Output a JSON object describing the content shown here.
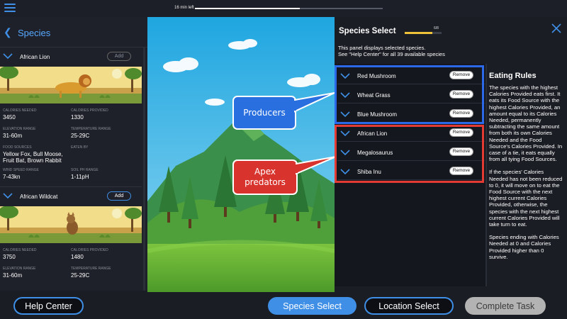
{
  "topbar": {
    "menu_icon": "hamburger-icon",
    "time_left": "16 min left",
    "progress": 0.56
  },
  "left_panel": {
    "title": "Species",
    "cards": [
      {
        "name": "African Lion",
        "add_label": "Add",
        "calories_needed_label": "CALORIES NEEDED",
        "calories_needed": "3450",
        "calories_provided_label": "CALORIES PROVIDED",
        "calories_provided": "1330",
        "elevation_label": "ELEVATION RANGE",
        "elevation": "31-60m",
        "temperature_label": "TEMPERATURE RANGE",
        "temperature": "25-29C",
        "food_sources_label": "FOOD SOURCES",
        "food_sources": "Yellow Fox, Bull Moose, Fruit Bat, Brown Rabbit",
        "eaten_by_label": "EATEN BY",
        "eaten_by": "",
        "wind_label": "WIND SPEED RANGE",
        "wind": "7-43kn",
        "soil_label": "SOIL PH RANGE",
        "soil": "1-11pH"
      },
      {
        "name": "African Wildcat",
        "add_label": "Add",
        "calories_needed_label": "CALORIES NEEDED",
        "calories_needed": "3750",
        "calories_provided_label": "CALORIES PROVIDED",
        "calories_provided": "1480",
        "elevation_label": "ELEVATION RANGE",
        "elevation": "31-60m",
        "temperature_label": "TEMPERATURE RANGE",
        "temperature": "25-29C"
      }
    ]
  },
  "scene": {
    "callout_producers": "Producers",
    "callout_apex": "Apex predators",
    "colors": {
      "producers": "#2a6fe0",
      "apex": "#d8332c"
    }
  },
  "right_panel": {
    "title": "Species Select",
    "count": "6/8",
    "progress": 0.75,
    "description_line1": "This panel displays selected species.",
    "description_line2": "See \"Help Center\" for all 39 available species",
    "remove_label": "Remove",
    "selected": [
      "Red Mushroom",
      "Wheat Grass",
      "Blue Mushroom",
      "African Lion",
      "Megalosaurus",
      "Shiba Inu"
    ],
    "rules_title": "Eating Rules",
    "rules_p1": "The species with the highest Calories Provided eats first. It eats its Food Source with the highest Calories Provided, an amount equal to its Calories Needed, permanently subtracting the same amount from both its own Calories Needed and the Food Source's Calories Provided. In case of a tie, it eats equally from all tying Food Sources.",
    "rules_p2": "If the species' Calories Needed has not been reduced to 0, it will move on to eat the Food Source with the next highest current Calories Provided, otherwise, the species with the next highest current Calories Provided will take turn to eat.",
    "rules_p3": "Species ending with Calories Needed at 0 and Calories Provided higher than 0 survive."
  },
  "bottom": {
    "help_center": "Help Center",
    "species_select": "Species Select",
    "location_select": "Location Select",
    "complete_task": "Complete Task"
  }
}
